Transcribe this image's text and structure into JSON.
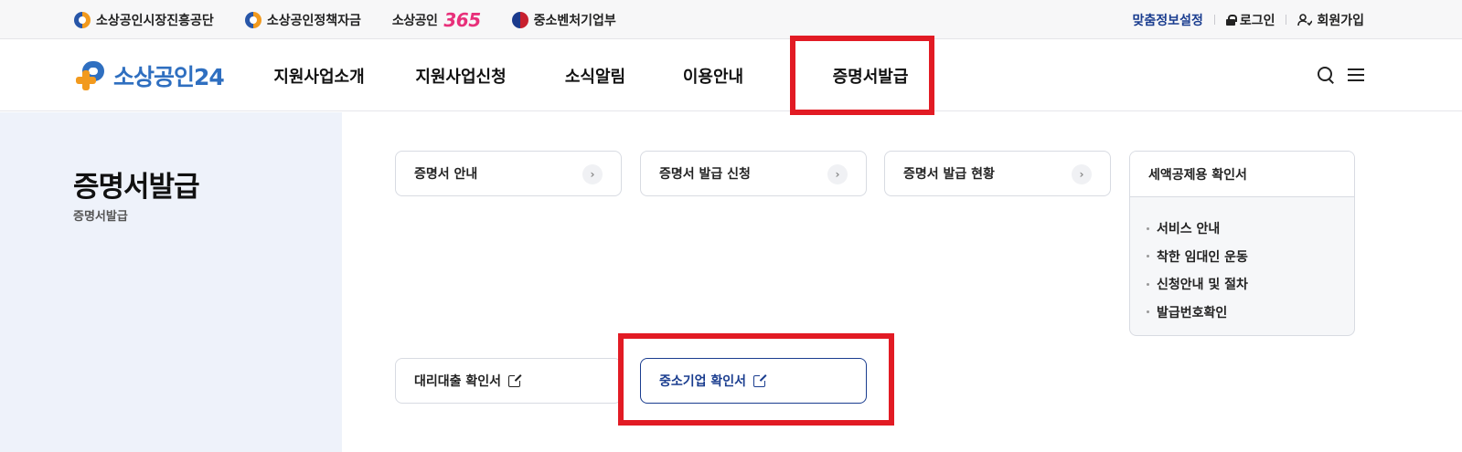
{
  "top_bar": {
    "sites": [
      {
        "label": "소상공인시장진흥공단",
        "icon": "sbiz-logo-icon"
      },
      {
        "label": "소상공인정책자금",
        "icon": "sbiz-logo-icon"
      },
      {
        "label_prefix": "소상공인",
        "label_number": "365"
      },
      {
        "label": "중소벤처기업부",
        "icon": "mss-emblem-icon"
      }
    ],
    "custom_info": "맞춤정보설정",
    "login": "로그인",
    "signup": "회원가입"
  },
  "header": {
    "brand": "소상공인24",
    "menu": [
      "지원사업소개",
      "지원사업신청",
      "소식알림",
      "이용안내",
      "증명서발급"
    ]
  },
  "sidebar": {
    "title": "증명서발급",
    "breadcrumb": "증명서발급"
  },
  "cards": {
    "guide": "증명서 안내",
    "apply": "증명서 발급 신청",
    "status": "증명서 발급 현황",
    "tax_credit": "세액공제용 확인서",
    "proxy_loan": "대리대출 확인서",
    "sme": "중소기업 확인서"
  },
  "dropdown": {
    "items": [
      "서비스 안내",
      "착한 임대인 운동",
      "신청안내 및 절차",
      "발급번호확인"
    ]
  },
  "colors": {
    "brand_blue": "#2f6fc0",
    "brand_orange": "#f29a1e",
    "highlight_red": "#e21b24",
    "sidebar_bg": "#eef2fa",
    "accent_navy": "#1a3d8f"
  }
}
